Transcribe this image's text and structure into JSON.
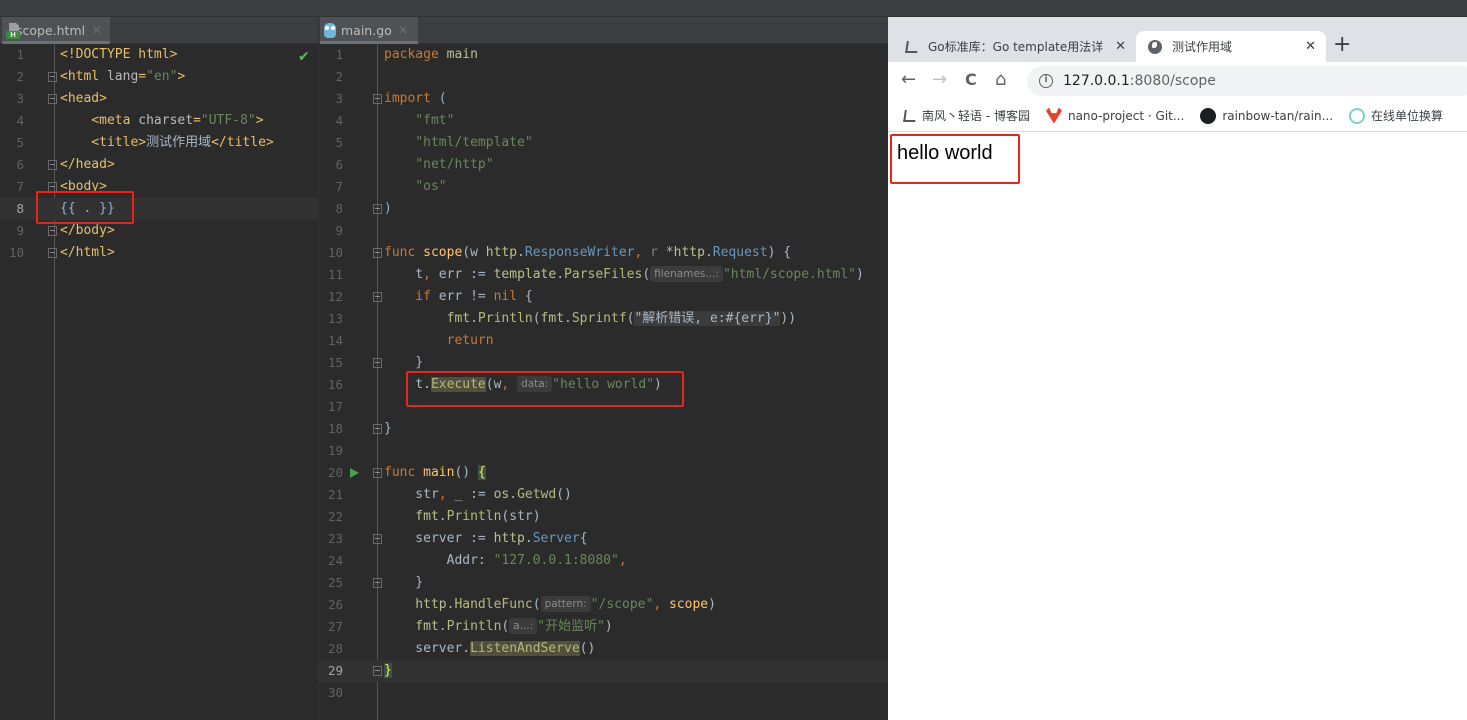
{
  "ide": {
    "left_pane": {
      "tab": {
        "label": "scope.html",
        "icon": "html-file-icon"
      },
      "lines": [
        {
          "n": "1"
        },
        {
          "n": "2"
        },
        {
          "n": "3"
        },
        {
          "n": "4"
        },
        {
          "n": "5"
        },
        {
          "n": "6"
        },
        {
          "n": "7"
        },
        {
          "n": "8"
        },
        {
          "n": "9"
        },
        {
          "n": "10"
        }
      ],
      "code": {
        "l1": "<!DOCTYPE html>",
        "l2a": "<html ",
        "l2b": "lang",
        "l2c": "=",
        "l2d": "\"en\"",
        "l2e": ">",
        "l3": "<head>",
        "l4a": "    <meta ",
        "l4b": "charset",
        "l4c": "=",
        "l4d": "\"UTF-8\"",
        "l4e": ">",
        "l5a": "    <title>",
        "l5b": "测试作用域",
        "l5c": "</title>",
        "l6": "</head>",
        "l7": "<body>",
        "l8": "{{ . }}",
        "l9": "</body>",
        "l10": "</html>"
      },
      "status_icon": "✔"
    },
    "mid_pane": {
      "tab": {
        "label": "main.go",
        "icon": "gopher-icon"
      },
      "line_numbers": [
        "1",
        "2",
        "3",
        "4",
        "5",
        "6",
        "7",
        "8",
        "9",
        "10",
        "11",
        "12",
        "13",
        "14",
        "15",
        "16",
        "17",
        "18",
        "19",
        "20",
        "21",
        "22",
        "23",
        "24",
        "25",
        "26",
        "27",
        "28",
        "29",
        "30"
      ],
      "code": {
        "l1a": "package",
        "l1b": " main",
        "l3a": "import",
        "l3b": " (",
        "l4": "    \"fmt\"",
        "l5": "    \"html/template\"",
        "l6": "    \"net/http\"",
        "l7": "    \"os\"",
        "l8": ")",
        "l10a": "func",
        "l10b": " scope",
        "l10c": "(w ",
        "l10d": "http",
        "l10e": ".",
        "l10f": "ResponseWriter",
        "l10g": ", ",
        "l10h": "r",
        "l10i": " *",
        "l10j": "http",
        "l10k": ".",
        "l10l": "Request",
        "l10m": ") {",
        "l11a": "    t",
        "l11b": ", ",
        "l11c": "err := ",
        "l11d": "template",
        "l11e": ".",
        "l11f": "ParseFiles",
        "l11g": "(",
        "l11hint": "filenames...:",
        "l11h": "\"html/scope.html\"",
        "l11i": ")",
        "l12a": "    if",
        "l12b": " err != ",
        "l12c": "nil",
        "l12d": " {",
        "l13a": "        fmt",
        "l13b": ".",
        "l13c": "Println",
        "l13d": "(",
        "l13e": "fmt",
        "l13f": ".",
        "l13g": "Sprintf",
        "l13h": "(",
        "l13i": "\"解析错误, e:#{err}\"",
        "l13j": "))",
        "l14": "        return",
        "l15": "    }",
        "l16a": "    t.",
        "l16b": "Execute",
        "l16c": "(w",
        "l16d": ", ",
        "l16hint": "data:",
        "l16e": "\"hello world\"",
        "l16f": ")",
        "l18": "}",
        "l20a": "func",
        "l20b": " main",
        "l20c": "() ",
        "l20d": "{",
        "l21a": "    str",
        "l21b": ", ",
        "l21c": "_ := ",
        "l21d": "os",
        "l21e": ".",
        "l21f": "Getwd",
        "l21g": "()",
        "l22a": "    fmt",
        "l22b": ".",
        "l22c": "Println",
        "l22d": "(str)",
        "l23a": "    server := ",
        "l23b": "http",
        "l23c": ".",
        "l23d": "Server",
        "l23e": "{",
        "l24a": "        Addr",
        "l24b": ": ",
        "l24c": "\"127.0.0.1:8080\"",
        "l24d": ",",
        "l25": "    }",
        "l26a": "    http",
        "l26b": ".",
        "l26c": "HandleFunc",
        "l26d": "(",
        "l26hint": "pattern:",
        "l26e": "\"/scope\"",
        "l26f": ", ",
        "l26g": "scope",
        "l26h": ")",
        "l27a": "    fmt",
        "l27b": ".",
        "l27c": "Println",
        "l27d": "(",
        "l27hint": "a...:",
        "l27e": "\"开始监听\"",
        "l27f": ")",
        "l28a": "    server.",
        "l28b": "ListenAndServe",
        "l28c": "()",
        "l29": "}"
      }
    }
  },
  "browser": {
    "tabs": [
      {
        "label": "Go标准库：Go template用法详",
        "icon": "blog-icon",
        "active": false
      },
      {
        "label": "测试作用域",
        "icon": "globe-icon",
        "active": true
      }
    ],
    "new_tab": "+",
    "nav": {
      "back": "←",
      "forward": "→",
      "reload": "C",
      "home": "⌂"
    },
    "url": {
      "host": "127.0.0.1",
      "rest": ":8080/scope"
    },
    "bookmarks": [
      {
        "label": "南风丶轻语 - 博客园",
        "icon": "blog-icon"
      },
      {
        "label": "nano-project · Git...",
        "icon": "gitlab-icon"
      },
      {
        "label": "rainbow-tan/rain...",
        "icon": "github-icon"
      },
      {
        "label": "在线单位换算",
        "icon": "atom-icon"
      }
    ],
    "page": {
      "text": "hello world"
    }
  }
}
